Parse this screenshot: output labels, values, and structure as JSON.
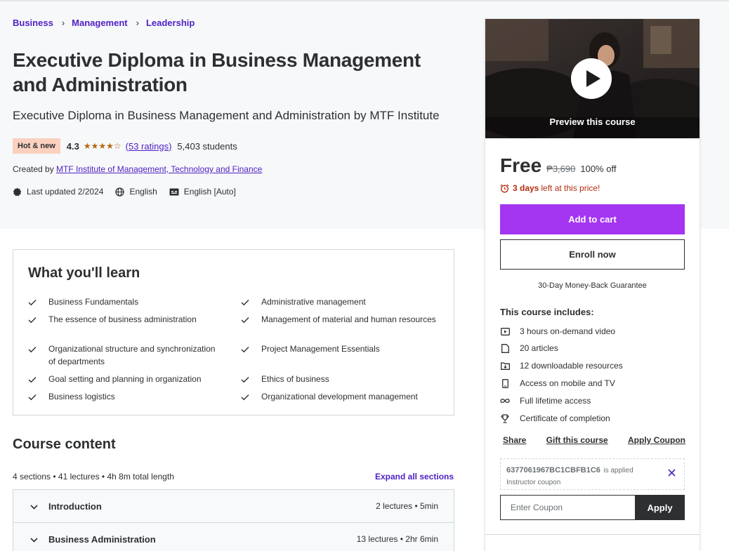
{
  "breadcrumb": [
    "Business",
    "Management",
    "Leadership"
  ],
  "course": {
    "title": "Executive Diploma in Business Management and Administration",
    "subtitle": "Executive Diploma in Business Management and Administration by MTF Institute",
    "badge": "Hot & new",
    "rating": "4.3",
    "stars": "★★★★☆",
    "rating_count": "(53 ratings)",
    "students": "5,403 students",
    "created_by_label": "Created by",
    "author": "MTF Institute of Management, Technology and Finance",
    "last_updated": "Last updated 2/2024",
    "language": "English",
    "captions": "English [Auto]"
  },
  "learn": {
    "title": "What you'll learn",
    "items": [
      "Business Fundamentals",
      "Administrative management",
      "The essence of business administration",
      "Management of material and human resources",
      "Organizational structure and synchronization of departments",
      "Project Management Essentials",
      "Goal setting and planning in organization",
      "Ethics of business",
      "Business logistics",
      "Organizational development management"
    ]
  },
  "content": {
    "title": "Course content",
    "meta": "4 sections • 41 lectures • 4h 8m total length",
    "expand_label": "Expand all sections",
    "sections": [
      {
        "name": "Introduction",
        "info": "2 lectures • 5min"
      },
      {
        "name": "Business Administration",
        "info": "13 lectures • 2hr 6min"
      }
    ]
  },
  "sidebar": {
    "preview_label": "Preview this course",
    "price": "Free",
    "original_price": "₱3,690",
    "discount": "100% off",
    "urgency_bold": "3 days",
    "urgency_rest": "left at this price!",
    "add_to_cart": "Add to cart",
    "enroll_now": "Enroll now",
    "guarantee": "30-Day Money-Back Guarantee",
    "includes_title": "This course includes:",
    "includes": [
      {
        "icon": "video-icon",
        "text": "3 hours on-demand video"
      },
      {
        "icon": "article-icon",
        "text": "20 articles"
      },
      {
        "icon": "download-icon",
        "text": "12 downloadable resources"
      },
      {
        "icon": "mobile-icon",
        "text": "Access on mobile and TV"
      },
      {
        "icon": "infinity-icon",
        "text": "Full lifetime access"
      },
      {
        "icon": "trophy-icon",
        "text": "Certificate of completion"
      }
    ],
    "share": "Share",
    "gift": "Gift this course",
    "apply_coupon": "Apply Coupon",
    "coupon_code": "6377061967BC1CBFB1C6",
    "coupon_applied": "is applied",
    "coupon_type": "Instructor coupon",
    "coupon_placeholder": "Enter Coupon",
    "coupon_apply_btn": "Apply"
  },
  "colors": {
    "accent_purple": "#a435f0",
    "link_purple": "#5022c3",
    "star_orange": "#b4690e",
    "urgency_red": "#b32d0f",
    "badge_bg": "#fbd0bf"
  }
}
